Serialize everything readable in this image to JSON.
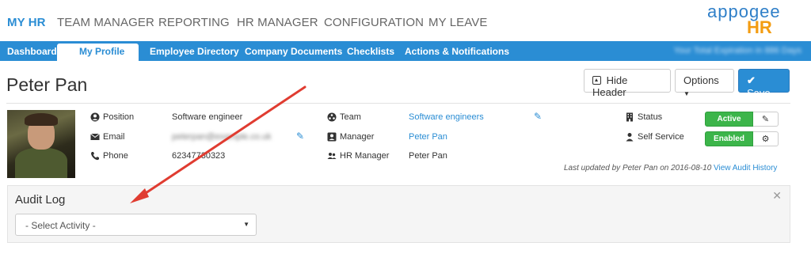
{
  "topnav": {
    "items": [
      "MY HR",
      "TEAM MANAGER",
      "REPORTING",
      "HR MANAGER",
      "CONFIGURATION",
      "MY LEAVE"
    ],
    "active_index": 0
  },
  "logo": {
    "line1": "appogee",
    "line2": "HR"
  },
  "subnav": {
    "items": [
      "Dashboard",
      "My Profile",
      "Employee Directory",
      "Company Documents",
      "Checklists",
      "Actions & Notifications"
    ],
    "active_index": 1,
    "right_text_blurred": "Your Total Expiration in 886 Days"
  },
  "page": {
    "title": "Peter Pan",
    "hide_header_label": "Hide Header",
    "options_label": "Options",
    "save_label": "Save"
  },
  "profile": {
    "position_label": "Position",
    "position_value": "Software engineer",
    "email_label": "Email",
    "email_value": "peterpan@example.co.uk",
    "phone_label": "Phone",
    "phone_value": "62347730323",
    "team_label": "Team",
    "team_value": "Software engineers",
    "manager_label": "Manager",
    "manager_value": "Peter Pan",
    "hr_manager_label": "HR Manager",
    "hr_manager_value": "Peter Pan",
    "status_label": "Status",
    "status_value": "Active",
    "self_service_label": "Self Service",
    "self_service_value": "Enabled",
    "last_updated": "Last updated by Peter Pan on 2016-08-10",
    "audit_link": "View Audit History"
  },
  "audit_log": {
    "title": "Audit Log",
    "select_value": "- Select Activity -"
  },
  "colors": {
    "accent": "#2a8dd4",
    "success": "#3cb54a",
    "annotation_arrow": "#e03c31",
    "logo_orange": "#f39c12"
  },
  "icons": [
    "user-icon",
    "envelope-icon",
    "phone-icon",
    "team-icon",
    "manager-icon",
    "hr-manager-icon",
    "building-icon",
    "person-icon",
    "pencil-icon",
    "gear-icon",
    "checkmark-icon",
    "close-icon"
  ]
}
